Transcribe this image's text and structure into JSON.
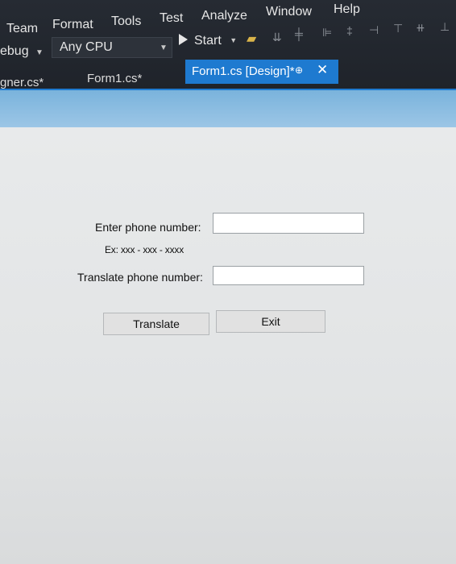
{
  "menu": {
    "items": [
      "Team",
      "Format",
      "Tools",
      "Test",
      "Analyze",
      "Window",
      "Help"
    ]
  },
  "toolbar": {
    "debug_label": "ebug",
    "platform": "Any CPU",
    "start_label": "Start"
  },
  "tabs": {
    "items": [
      {
        "label": "gner.cs*"
      },
      {
        "label": "Form1.cs*"
      },
      {
        "label": "Form1.cs [Design]*",
        "active": true
      }
    ]
  },
  "form": {
    "phone_label": "Enter phone number:",
    "example_label": "Ex: xxx - xxx - xxxx",
    "translate_label": "Translate phone number:",
    "phone_value": "",
    "translated_value": "",
    "translate_button": "Translate",
    "exit_button": "Exit"
  },
  "colors": {
    "accent": "#1e7ad0",
    "ide_background": "#22262d",
    "form_titlebar": "#8bbde2",
    "form_background": "#e4e6e7"
  }
}
